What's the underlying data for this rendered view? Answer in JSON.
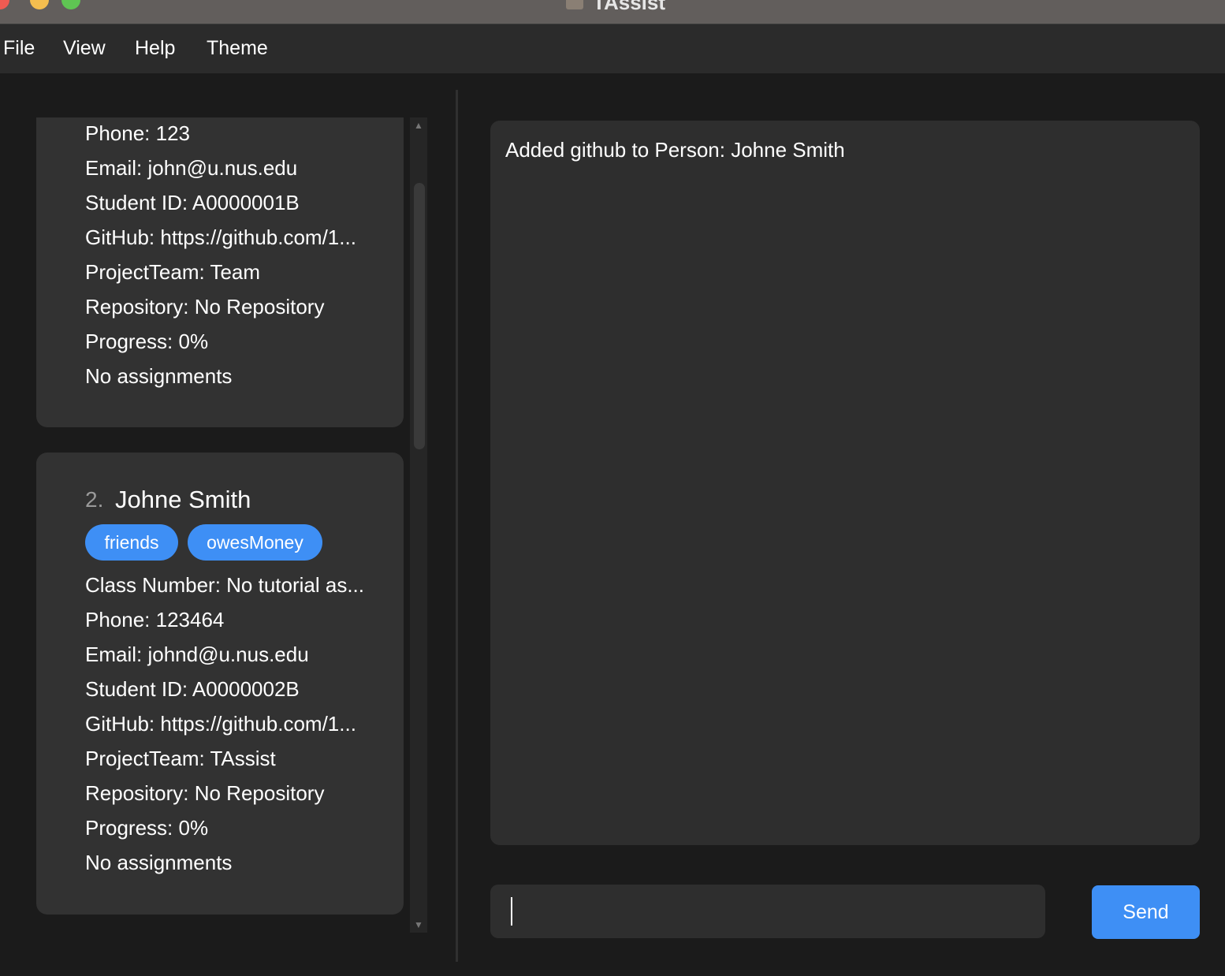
{
  "window": {
    "title": "TAssist"
  },
  "menu": {
    "file": "File",
    "view": "View",
    "help": "Help",
    "theme": "Theme"
  },
  "persons": [
    {
      "phone": "Phone: 123",
      "email": "Email: john@u.nus.edu",
      "student_id": "Student ID: A0000001B",
      "github": "GitHub: https://github.com/1...",
      "project_team": "ProjectTeam: Team",
      "repository": "Repository: No Repository",
      "progress": "Progress: 0%",
      "assignments": "No assignments"
    },
    {
      "index": "2.",
      "name": "Johne Smith",
      "tags": [
        "friends",
        "owesMoney"
      ],
      "class_number": "Class Number: No tutorial as...",
      "phone": "Phone: 123464",
      "email": "Email: johnd@u.nus.edu",
      "student_id": "Student ID: A0000002B",
      "github": "GitHub: https://github.com/1...",
      "project_team": "ProjectTeam: TAssist",
      "repository": "Repository: No Repository",
      "progress": "Progress: 0%",
      "assignments": "No assignments"
    }
  ],
  "result_display": {
    "message": "Added github to Person: Johne Smith"
  },
  "command_box": {
    "value": ""
  },
  "send_button": {
    "label": "Send"
  },
  "colors": {
    "accent": "#3e8ff5",
    "card": "#323232",
    "panel": "#2e2e2e",
    "background": "#1b1b1b"
  }
}
